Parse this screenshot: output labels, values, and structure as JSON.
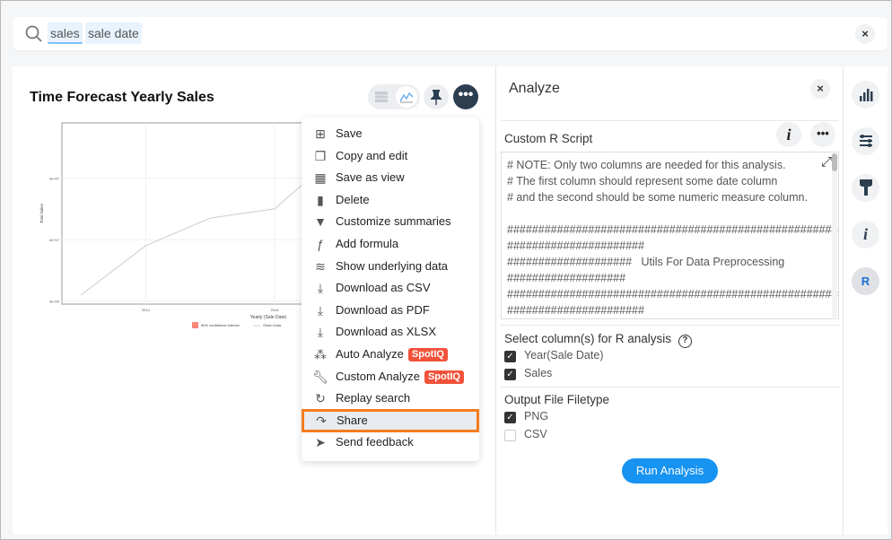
{
  "search": {
    "tokens": [
      "sales",
      "sale date"
    ],
    "clear_label": "×"
  },
  "chart_card": {
    "title": "Time Forecast Yearly Sales",
    "more_label": "•••"
  },
  "chart_data": {
    "type": "line",
    "xlabel": "Yearly (Sale Date)",
    "ylabel": "Total Sales",
    "x_ticks": [
      "2014",
      "2016"
    ],
    "y_ticks": [
      "0e+00",
      "2e+07",
      "4e+07"
    ],
    "xlim": [
      2012.7,
      2016.6
    ],
    "ylim": [
      -1000000.0,
      58000000.0
    ],
    "grid": true,
    "series": [
      {
        "name": "Given Data",
        "color": "#cccccc",
        "x": [
          2013,
          2014,
          2015,
          2016,
          2016.6
        ],
        "y": [
          2000000.0,
          18000000.0,
          27000000.0,
          30000000.0,
          41000000.0
        ]
      }
    ],
    "legend": {
      "placement": "bottom",
      "items": [
        "80% confidence interval",
        "Given Data"
      ],
      "colors": [
        "#f8877a",
        "#cccccc",
        "#f2523a"
      ]
    }
  },
  "menu": {
    "items": [
      {
        "label": "Save",
        "icon": "plus-box-icon"
      },
      {
        "label": "Copy and edit",
        "icon": "copy-icon"
      },
      {
        "label": "Save as view",
        "icon": "table-icon"
      },
      {
        "label": "Delete",
        "icon": "trash-icon"
      },
      {
        "label": "Customize summaries",
        "icon": "filter-icon"
      },
      {
        "label": "Add formula",
        "icon": "formula-icon"
      },
      {
        "label": "Show underlying data",
        "icon": "layers-icon"
      },
      {
        "label": "Download as CSV",
        "icon": "download-icon"
      },
      {
        "label": "Download as PDF",
        "icon": "download-icon"
      },
      {
        "label": "Download as XLSX",
        "icon": "download-icon"
      },
      {
        "label": "Auto Analyze",
        "icon": "magic-wand-icon",
        "badge": "SpotIQ"
      },
      {
        "label": "Custom Analyze",
        "icon": "wrench-icon",
        "badge": "SpotIQ"
      },
      {
        "label": "Replay search",
        "icon": "replay-icon"
      },
      {
        "label": "Share",
        "icon": "share-icon",
        "highlighted": true
      },
      {
        "label": "Send feedback",
        "icon": "send-icon"
      }
    ],
    "badge_color": "#f2523a",
    "highlight_color": "#f57c1f"
  },
  "analyze": {
    "title": "Analyze",
    "close_label": "×",
    "script_label": "Custom R Script",
    "info_label": "i",
    "more_label": "•••",
    "script": "# NOTE: Only two columns are needed for this analysis.\n# The first column should represent some date column\n# and the second should be some numeric measure column.\n\n##########################################################\n######################\n####################   Utils For Data Preprocessing\n###################\n##########################################################\n######################",
    "columns_label": "Select column(s) for R analysis",
    "columns": [
      {
        "label": "Year(Sale Date)",
        "checked": true
      },
      {
        "label": "Sales",
        "checked": true
      }
    ],
    "filetype_label": "Output File Filetype",
    "filetypes": [
      {
        "label": "PNG",
        "checked": true
      },
      {
        "label": "CSV",
        "checked": false
      }
    ],
    "run_label": "Run Analysis",
    "accent": "#1793f2"
  },
  "sidebar": {
    "items": [
      {
        "icon": "bar-chart-icon"
      },
      {
        "icon": "settings-sliders-icon"
      },
      {
        "icon": "paintbrush-icon"
      },
      {
        "icon": "info-icon",
        "label": "i"
      },
      {
        "icon": "r-icon",
        "label": "R",
        "active": true
      }
    ]
  }
}
